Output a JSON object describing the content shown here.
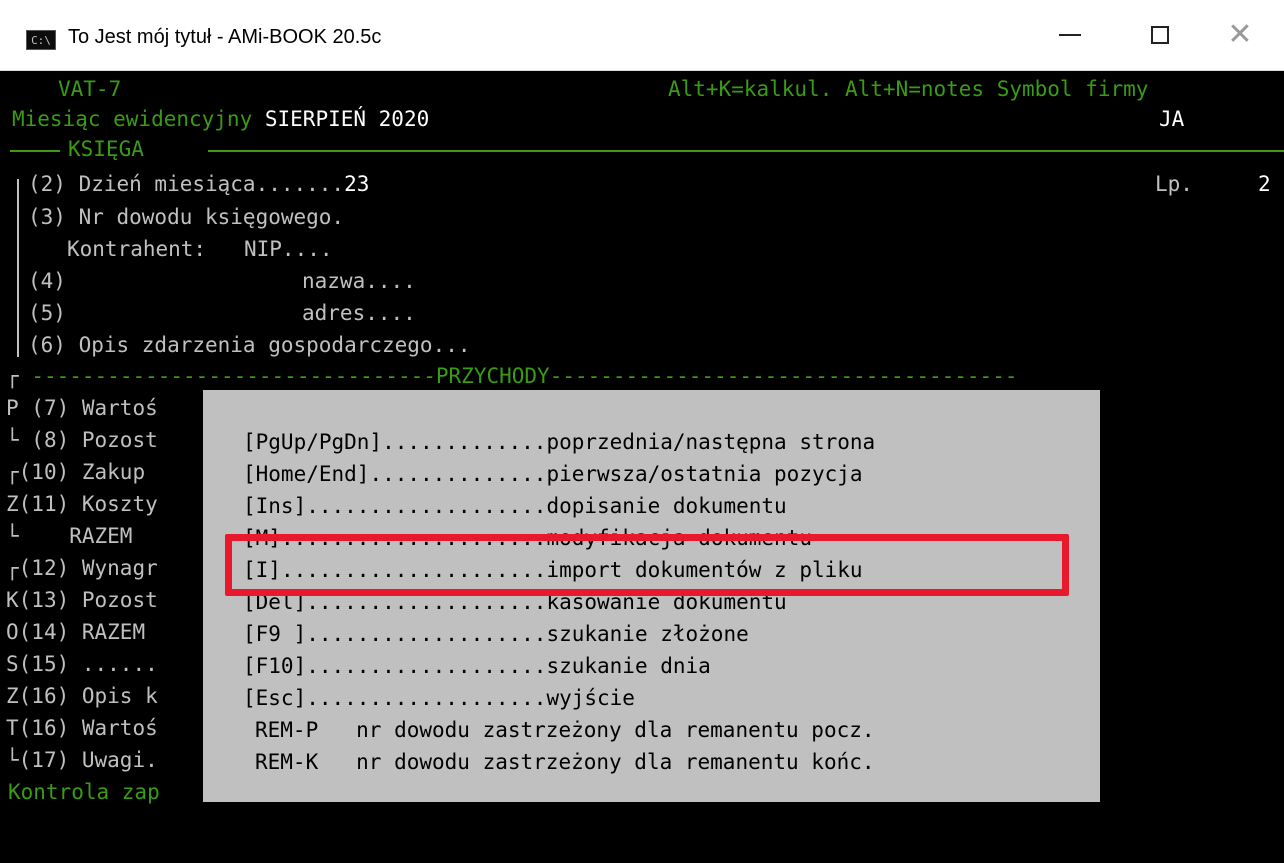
{
  "window": {
    "title": "To Jest mój tytuł - AMi-BOOK 20.5c",
    "icon_label": "C:\\",
    "icon": "console-icon",
    "controls": [
      "minimize-icon",
      "maximize-icon",
      "close-icon"
    ]
  },
  "header": {
    "form": "VAT-7",
    "hint": "Alt+K=kalkul. Alt+N=notes Symbol firmy",
    "month_label": "Miesiąc ewidencyjny",
    "month_value": "SIERPIEŃ 2020",
    "symbol_value": "JA"
  },
  "section_ksiega": "KSIĘGA",
  "fields": {
    "r2_label": "(2) Dzień miesiąca.......",
    "r2_value": "23",
    "lp_label": "Lp.",
    "lp_value": "2",
    "r3": "(3) Nr dowodu księgowego.",
    "kontrahent": "Kontrahent:   NIP....",
    "r4_num": "(4)",
    "r4_label": "nazwa....",
    "r5_num": "(5)",
    "r5_label": "adres....",
    "r6": "(6) Opis zdarzenia gospodarczego..."
  },
  "section_przychody": "PRZYCHODY",
  "left_rows": [
    {
      "prefix": "P",
      "text": " (7) Wartoś"
    },
    {
      "prefix": "└",
      "text": " (8) Pozost"
    },
    {
      "prefix": "┌",
      "text": "(10) Zakup "
    },
    {
      "prefix": "Z",
      "text": "(11) Koszty"
    },
    {
      "prefix": "└",
      "text": "    RAZEM "
    },
    {
      "prefix": "┌",
      "text": "(12) Wynagr"
    },
    {
      "prefix": "K",
      "text": "(13) Pozost"
    },
    {
      "prefix": "O",
      "text": "(14) RAZEM "
    },
    {
      "prefix": "S",
      "text": "(15) ......"
    },
    {
      "prefix": "Z",
      "text": "(16) Opis k"
    },
    {
      "prefix": "T",
      "text": "(16) Wartoś"
    },
    {
      "prefix": "└",
      "text": "(17) Uwagi."
    }
  ],
  "footer": "Kontrola zap",
  "help_popup": {
    "items": [
      {
        "key": "[PgUp/PgDn]",
        "dots": ".............",
        "desc": "poprzednia/następna strona"
      },
      {
        "key": "[Home/End]",
        "dots": "..............",
        "desc": "pierwsza/ostatnia pozycja"
      },
      {
        "key": "[Ins]",
        "dots": "...................",
        "desc": "dopisanie dokumentu"
      },
      {
        "key": "[M]",
        "dots": ".....................",
        "desc": "modyfikacja dokumentu"
      },
      {
        "key": "[I]",
        "dots": ".....................",
        "desc": "import dokumentów z pliku"
      },
      {
        "key": "[Del]",
        "dots": "...................",
        "desc": "kasowanie dokumentu"
      },
      {
        "key": "[F9 ]",
        "dots": "...................",
        "desc": "szukanie złożone"
      },
      {
        "key": "[F10]",
        "dots": "...................",
        "desc": "szukanie dnia"
      },
      {
        "key": "[Esc]",
        "dots": "...................",
        "desc": "wyjście"
      }
    ],
    "remarks": [
      {
        "key": "REM-P",
        "desc": "nr dowodu zastrzeżony dla remanentu pocz."
      },
      {
        "key": "REM-K",
        "desc": "nr dowodu zastrzeżony dla remanentu końc."
      }
    ],
    "highlight_color": "#e8192c"
  },
  "colors": {
    "green": "#3a9b15",
    "gray": "#c0c0c0",
    "white": "#ffffff",
    "background": "#000000"
  }
}
